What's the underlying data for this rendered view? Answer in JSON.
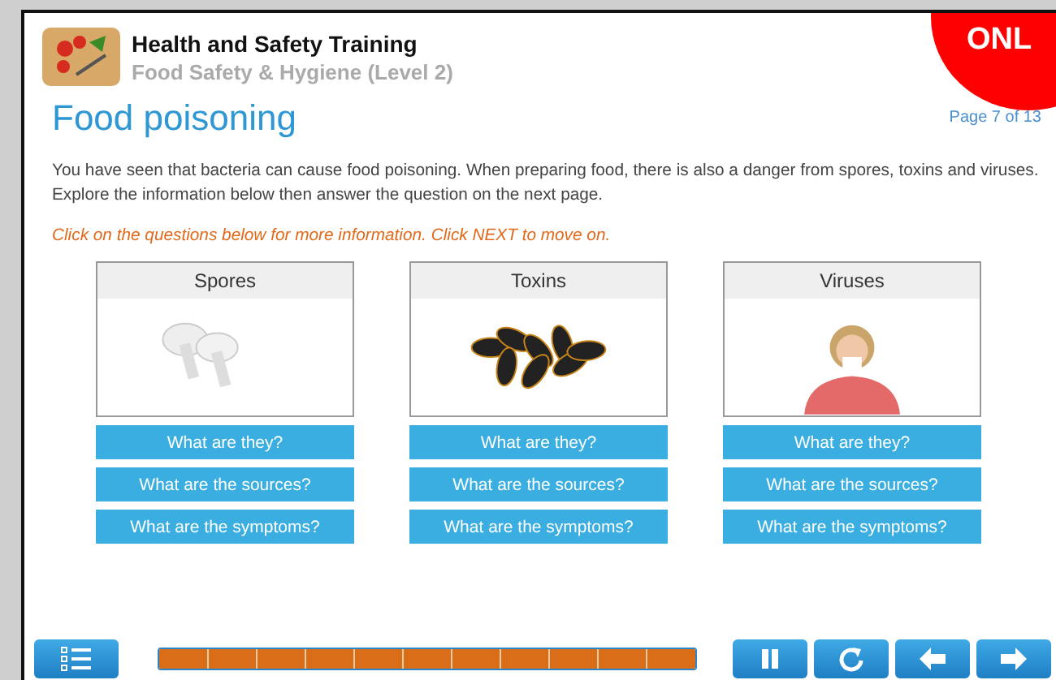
{
  "header": {
    "title": "Health and Safety Training",
    "subtitle": "Food Safety & Hygiene (Level 2)",
    "badge": "ONL"
  },
  "page": {
    "heading": "Food poisoning",
    "counter": "Page 7 of 13",
    "intro": "You have seen that bacteria can cause food poisoning. When preparing food, there is also a danger from spores, toxins and viruses. Explore the information below then answer the question on the next page.",
    "instruction": "Click on the questions below for more information. Click NEXT to move on."
  },
  "cards": [
    {
      "title": "Spores",
      "kind": "mushrooms",
      "questions": [
        "What are they?",
        "What are the sources?",
        "What are the symptoms?"
      ]
    },
    {
      "title": "Toxins",
      "kind": "mussels",
      "questions": [
        "What are they?",
        "What are the sources?",
        "What are the symptoms?"
      ]
    },
    {
      "title": "Viruses",
      "kind": "person",
      "questions": [
        "What are they?",
        "What are the sources?",
        "What are the symptoms?"
      ]
    }
  ],
  "progress": {
    "level": 1
  }
}
